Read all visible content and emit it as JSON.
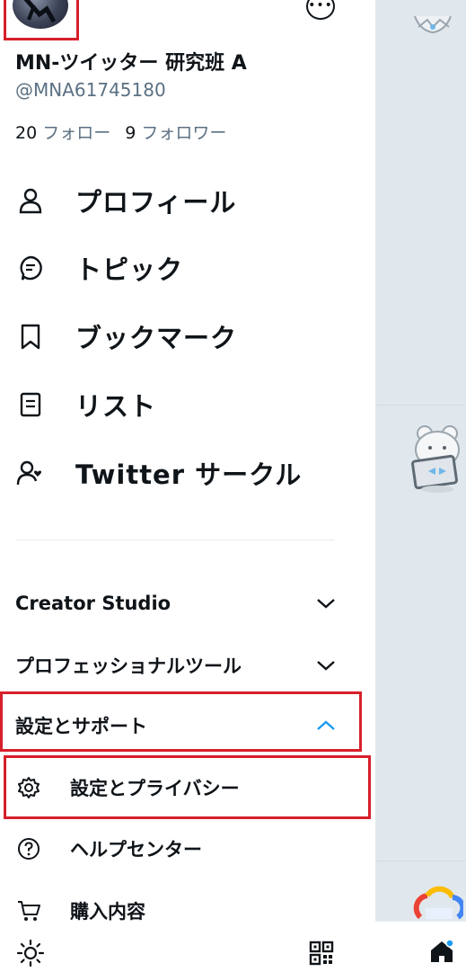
{
  "profile": {
    "display_name": "MN-ツイッター 研究班 A",
    "handle": "@MNA61745180",
    "following_count": "20",
    "following_label": "フォロー",
    "followers_count": "9",
    "followers_label": "フォロワー"
  },
  "nav": [
    {
      "label": "プロフィール",
      "icon": "person-icon"
    },
    {
      "label": "トピック",
      "icon": "topic-bubble-icon"
    },
    {
      "label": "ブックマーク",
      "icon": "bookmark-icon"
    },
    {
      "label": "リスト",
      "icon": "list-icon"
    },
    {
      "label": "Twitter サークル",
      "icon": "circle-people-icon"
    }
  ],
  "sections": {
    "creator_studio": "Creator Studio",
    "professional_tools": "プロフェッショナルツール",
    "settings_support": "設定とサポート"
  },
  "sub_items": [
    {
      "label": "設定とプライバシー",
      "icon": "gear-icon"
    },
    {
      "label": "ヘルプセンター",
      "icon": "help-circle-icon"
    },
    {
      "label": "購入内容",
      "icon": "cart-icon"
    }
  ],
  "colors": {
    "accent": "#1d9bf0",
    "highlight": "#d6202b",
    "backdrop": "#e1e8ed"
  }
}
